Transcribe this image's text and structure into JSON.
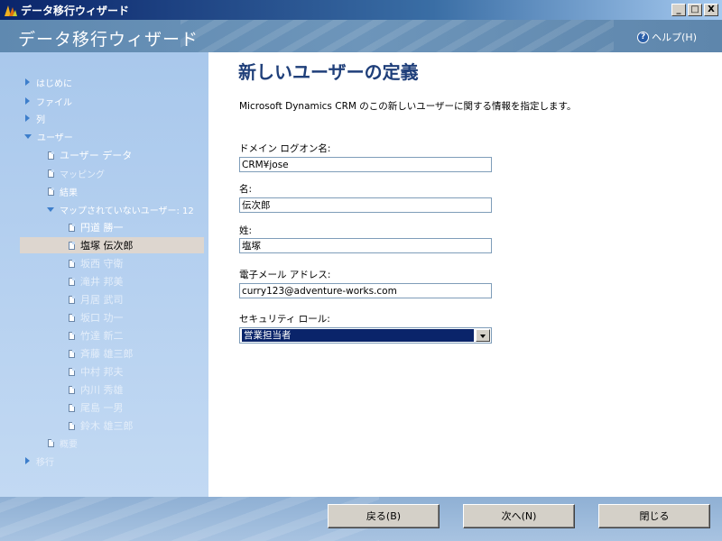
{
  "window": {
    "title": "データ移行ウィザード",
    "minimize": "_",
    "maximize": "□",
    "close": "X"
  },
  "header": {
    "title": "データ移行ウィザード",
    "help": "ヘルプ(H)"
  },
  "sidebar": {
    "items": [
      {
        "label": "はじめに"
      },
      {
        "label": "ファイル"
      },
      {
        "label": "列"
      },
      {
        "label": "ユーザー"
      },
      {
        "label": "ユーザー データ"
      },
      {
        "label": "マッピング"
      },
      {
        "label": "結果"
      },
      {
        "label": "マップされていないユーザー: 12"
      },
      {
        "label": "円道 勝一"
      },
      {
        "label": "塩塚 伝次郎"
      },
      {
        "label": "坂西 守衛"
      },
      {
        "label": "滝井 邦美"
      },
      {
        "label": "月居 武司"
      },
      {
        "label": "坂口 功一"
      },
      {
        "label": "竹達 新二"
      },
      {
        "label": "斉藤 雄三郎"
      },
      {
        "label": "中村 邦夫"
      },
      {
        "label": "内川 秀雄"
      },
      {
        "label": "尾島 一男"
      },
      {
        "label": "鈴木 雄三郎"
      },
      {
        "label": "概要"
      },
      {
        "label": "移行"
      }
    ]
  },
  "main": {
    "title": "新しいユーザーの定義",
    "description": "Microsoft Dynamics CRM のこの新しいユーザーに関する情報を指定します。",
    "fields": {
      "domain": {
        "label": "ドメイン ログオン名:",
        "value": "CRM¥jose"
      },
      "first_name": {
        "label": "名:",
        "value": "伝次郎"
      },
      "last_name": {
        "label": "姓:",
        "value": "塩塚"
      },
      "email": {
        "label": "電子メール アドレス:",
        "value": "curry123@adventure-works.com"
      },
      "role": {
        "label": "セキュリティ ロール:",
        "value": "営業担当者"
      }
    }
  },
  "footer": {
    "back": "戻る(B)",
    "next": "次へ(N)",
    "close": "閉じる"
  }
}
